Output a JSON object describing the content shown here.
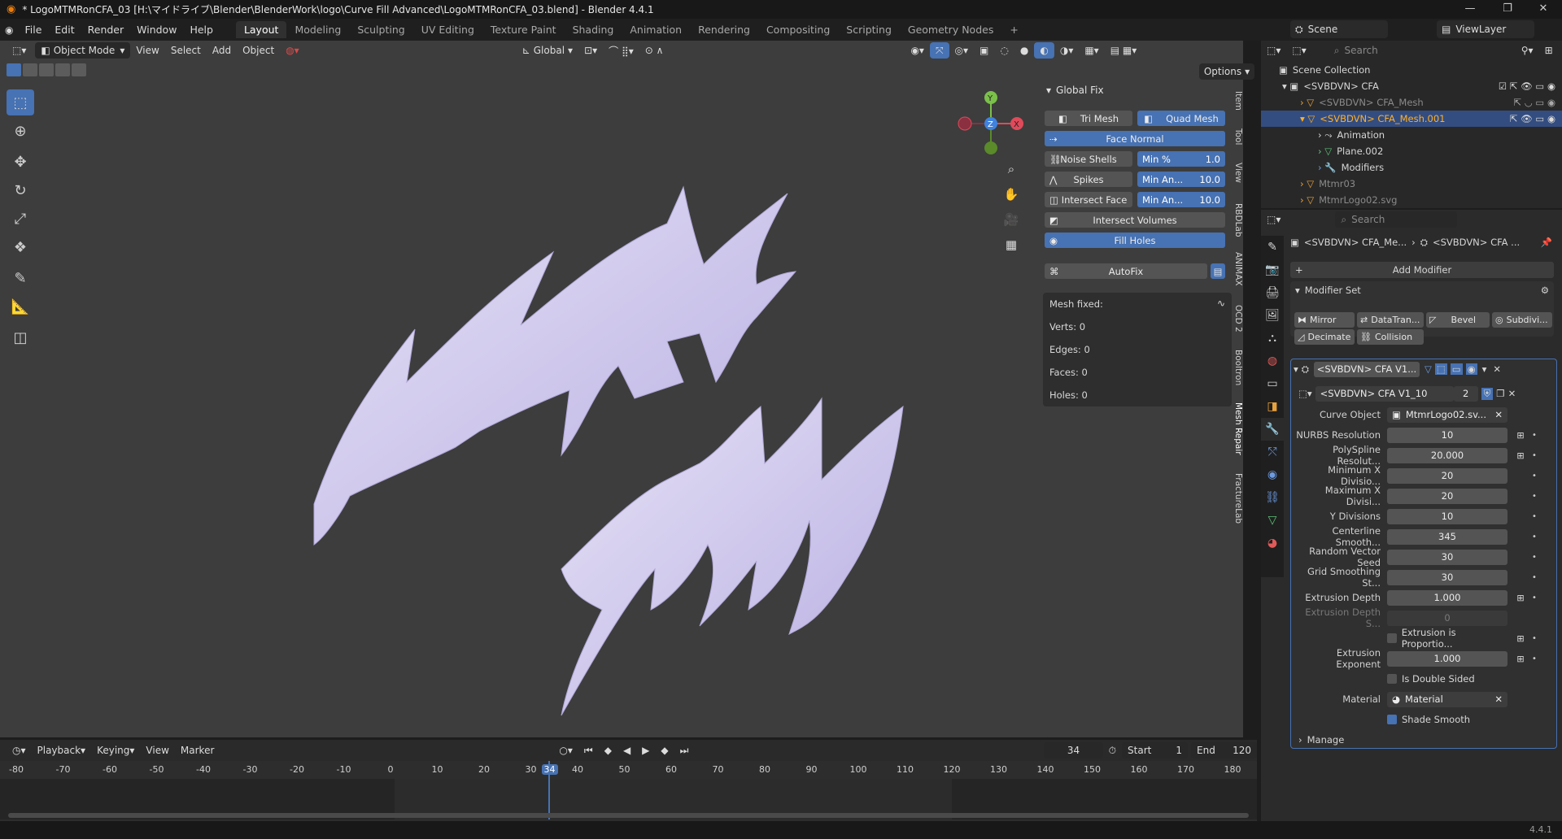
{
  "window": {
    "title": "* LogoMTMRonCFA_03 [H:\\マイドライブ\\Blender\\BlenderWork\\logo\\Curve Fill Advanced\\LogoMTMRonCFA_03.blend] - Blender 4.4.1"
  },
  "menu": {
    "items": [
      "File",
      "Edit",
      "Render",
      "Window",
      "Help"
    ]
  },
  "workspaces": [
    "Layout",
    "Modeling",
    "Sculpting",
    "UV Editing",
    "Texture Paint",
    "Shading",
    "Animation",
    "Rendering",
    "Compositing",
    "Scripting",
    "Geometry Nodes"
  ],
  "scene": {
    "name": "Scene",
    "view_layer": "ViewLayer"
  },
  "viewport_header": {
    "mode": "Object Mode",
    "menus": [
      "View",
      "Select",
      "Add",
      "Object"
    ],
    "transform": "Global",
    "options": "Options"
  },
  "n_panel": {
    "section": "Global Fix",
    "tri_mesh": "Tri Mesh",
    "quad_mesh": "Quad Mesh",
    "face_normal": "Face Normal",
    "noise_shells": "Noise Shells",
    "min_pct_label": "Min %",
    "min_pct_value": "1.0",
    "spikes": "Spikes",
    "min_an_label": "Min An...",
    "spikes_value": "10.0",
    "intersect_face": "Intersect Face",
    "intersect_value": "10.0",
    "intersect_volumes": "Intersect Volumes",
    "fill_holes": "Fill Holes",
    "autofix": "AutoFix",
    "mesh_fixed": "Mesh fixed:",
    "verts": "Verts: 0",
    "edges": "Edges: 0",
    "faces": "Faces: 0",
    "holes": "Holes: 0"
  },
  "side_tabs": [
    "Item",
    "Tool",
    "View",
    "RBDLab",
    "ANIMAX",
    "OCD 2",
    "Booltron",
    "Mesh Repair",
    "FractureLab"
  ],
  "timeline": {
    "menus": [
      "Playback",
      "Keying",
      "View",
      "Marker"
    ],
    "current_frame": "34",
    "start_label": "Start",
    "start": "1",
    "end_label": "End",
    "end": "120",
    "ticks": [
      "-80",
      "-70",
      "-60",
      "-50",
      "-40",
      "-30",
      "-20",
      "-10",
      "0",
      "10",
      "20",
      "30",
      "34",
      "40",
      "50",
      "60",
      "70",
      "80",
      "90",
      "100",
      "110",
      "120",
      "130",
      "140",
      "150",
      "160",
      "170",
      "180"
    ]
  },
  "outliner": {
    "search_placeholder": "Search",
    "rows": [
      "Scene Collection",
      "<SVBDVN> CFA",
      "<SVBDVN> CFA_Mesh",
      "<SVBDVN> CFA_Mesh.001",
      "Animation",
      "Plane.002",
      "Modifiers",
      "Mtmr03",
      "MtmrLogo02.svg"
    ]
  },
  "properties": {
    "search_placeholder": "Search",
    "breadcrumb_obj": "<SVBDVN> CFA_Me...",
    "breadcrumb_mod": "<SVBDVN> CFA ...",
    "add_modifier": "Add Modifier",
    "modifier_set": "Modifier Set",
    "mod_buttons": [
      "Mirror",
      "DataTran...",
      "Bevel",
      "Subdivi...",
      "Decimate",
      "Collision"
    ],
    "modifier_name": "<SVBDVN> CFA V1...",
    "node_group": "<SVBDVN> CFA V1_10",
    "node_users": "2",
    "fields": [
      {
        "label": "Curve Object",
        "value": "MtmrLogo02.sv..."
      },
      {
        "label": "NURBS Resolution",
        "value": "10"
      },
      {
        "label": "PolySpline Resolut...",
        "value": "20.000"
      },
      {
        "label": "Minimum X Divisio...",
        "value": "20"
      },
      {
        "label": "Maximum X Divisi...",
        "value": "20"
      },
      {
        "label": "Y Divisions",
        "value": "10"
      },
      {
        "label": "Centerline Smooth...",
        "value": "345"
      },
      {
        "label": "Random Vector Seed",
        "value": "30"
      },
      {
        "label": "Grid Smoothing St...",
        "value": "30"
      },
      {
        "label": "Extrusion Depth",
        "value": "1.000"
      },
      {
        "label": "Extrusion Depth S...",
        "value": "0"
      }
    ],
    "extrusion_prop": "Extrusion is Proportio...",
    "extrusion_exp_label": "Extrusion Exponent",
    "extrusion_exp": "1.000",
    "double_sided": "Is Double Sided",
    "material_label": "Material",
    "material": "Material",
    "shade_smooth": "Shade Smooth",
    "manage": "Manage"
  },
  "status": {
    "version": "4.4.1"
  },
  "colors": {
    "accent": "#4772b3",
    "selected_text": "#ffaf29",
    "mesh": "#d9d4f0"
  }
}
